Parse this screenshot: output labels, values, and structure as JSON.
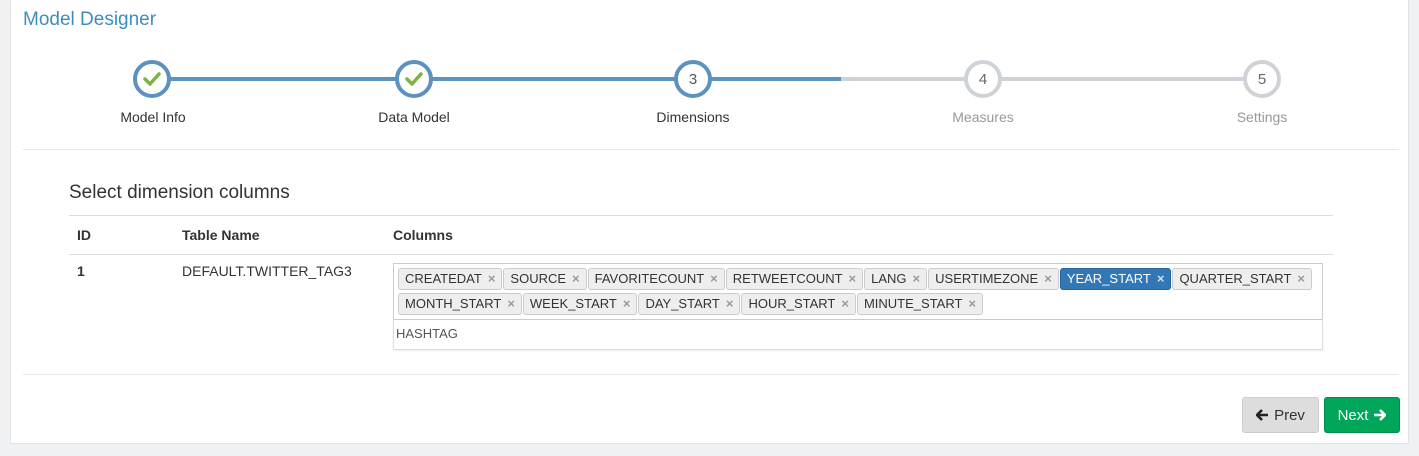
{
  "header": {
    "title": "Model Designer"
  },
  "wizard": {
    "steps": [
      {
        "number": "1",
        "label": "Model Info",
        "state": "done"
      },
      {
        "number": "2",
        "label": "Data Model",
        "state": "done"
      },
      {
        "number": "3",
        "label": "Dimensions",
        "state": "current"
      },
      {
        "number": "4",
        "label": "Measures",
        "state": "todo"
      },
      {
        "number": "5",
        "label": "Settings",
        "state": "todo"
      }
    ],
    "done_icon": "check-icon"
  },
  "section": {
    "title": "Select dimension columns",
    "headers": {
      "id": "ID",
      "table": "Table Name",
      "columns": "Columns"
    },
    "rows": [
      {
        "id": "1",
        "table": "DEFAULT.TWITTER_TAG3",
        "tags": [
          "CREATEDAT",
          "SOURCE",
          "FAVORITECOUNT",
          "RETWEETCOUNT",
          "LANG",
          "USERTIMEZONE",
          "YEAR_START",
          "QUARTER_START",
          "MONTH_START",
          "WEEK_START",
          "DAY_START",
          "HOUR_START",
          "MINUTE_START"
        ],
        "selected_tag": "YEAR_START",
        "dropdown_option": "HASHTAG"
      }
    ]
  },
  "buttons": {
    "prev": "Prev",
    "next": "Next"
  },
  "colors": {
    "accent": "#3c8dbc",
    "step": "#5b92c0",
    "step_todo": "#cfd3d8",
    "check": "#7cb342",
    "next": "#00a65a",
    "tag_selected": "#3278b6"
  }
}
